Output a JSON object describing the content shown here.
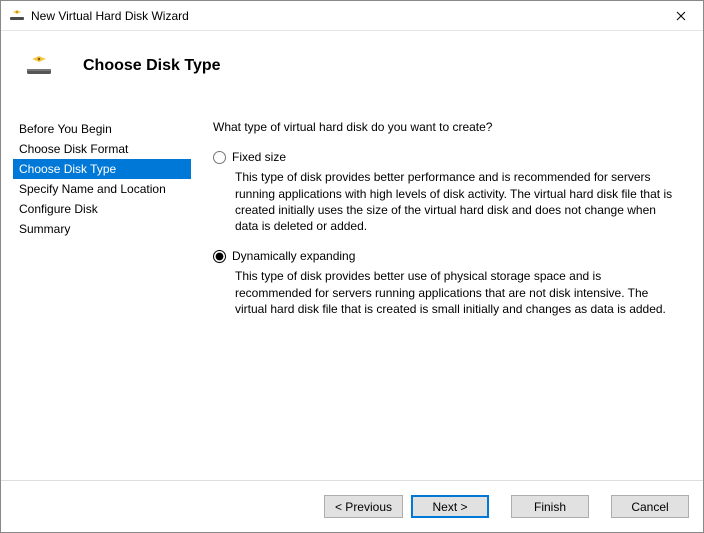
{
  "window": {
    "title": "New Virtual Hard Disk Wizard"
  },
  "header": {
    "heading": "Choose Disk Type"
  },
  "sidebar": {
    "items": [
      {
        "label": "Before You Begin",
        "selected": false
      },
      {
        "label": "Choose Disk Format",
        "selected": false
      },
      {
        "label": "Choose Disk Type",
        "selected": true
      },
      {
        "label": "Specify Name and Location",
        "selected": false
      },
      {
        "label": "Configure Disk",
        "selected": false
      },
      {
        "label": "Summary",
        "selected": false
      }
    ]
  },
  "content": {
    "prompt": "What type of virtual hard disk do you want to create?",
    "options": [
      {
        "id": "fixed",
        "label": "Fixed size",
        "selected": false,
        "description": "This type of disk provides better performance and is recommended for servers running applications with high levels of disk activity. The virtual hard disk file that is created initially uses the size of the virtual hard disk and does not change when data is deleted or added."
      },
      {
        "id": "dynamic",
        "label": "Dynamically expanding",
        "selected": true,
        "description": "This type of disk provides better use of physical storage space and is recommended for servers running applications that are not disk intensive. The virtual hard disk file that is created is small initially and changes as data is added."
      }
    ]
  },
  "footer": {
    "previous": "< Previous",
    "next": "Next >",
    "finish": "Finish",
    "cancel": "Cancel"
  }
}
